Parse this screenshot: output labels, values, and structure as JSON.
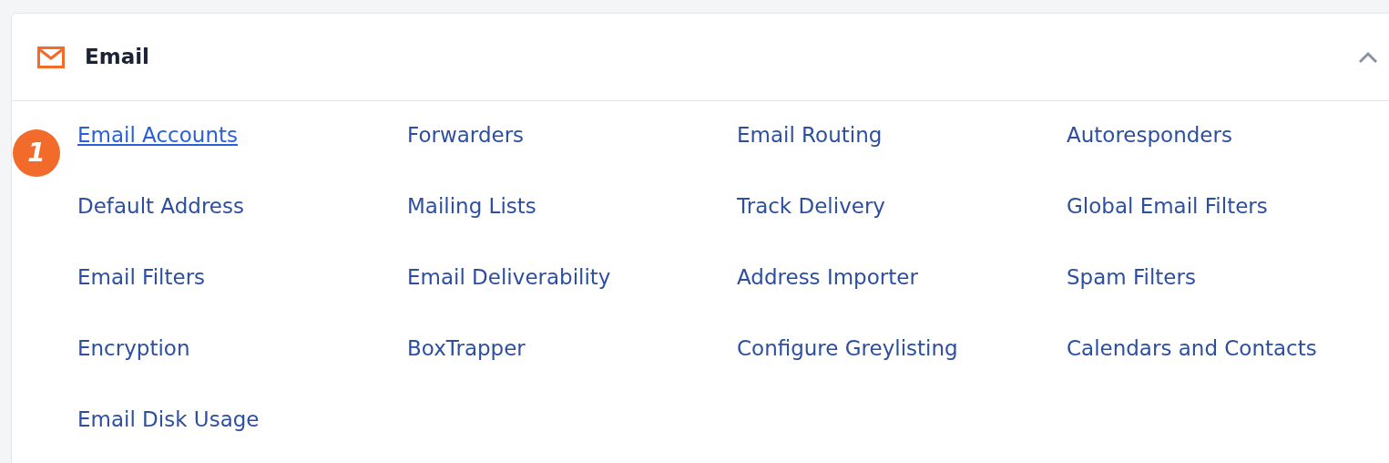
{
  "section": {
    "title": "Email",
    "expanded": true
  },
  "callout": {
    "label": "1"
  },
  "links": [
    {
      "label": "Email Accounts",
      "highlighted": true
    },
    {
      "label": "Forwarders",
      "highlighted": false
    },
    {
      "label": "Email Routing",
      "highlighted": false
    },
    {
      "label": "Autoresponders",
      "highlighted": false
    },
    {
      "label": "Default Address",
      "highlighted": false
    },
    {
      "label": "Mailing Lists",
      "highlighted": false
    },
    {
      "label": "Track Delivery",
      "highlighted": false
    },
    {
      "label": "Global Email Filters",
      "highlighted": false
    },
    {
      "label": "Email Filters",
      "highlighted": false
    },
    {
      "label": "Email Deliverability",
      "highlighted": false
    },
    {
      "label": "Address Importer",
      "highlighted": false
    },
    {
      "label": "Spam Filters",
      "highlighted": false
    },
    {
      "label": "Encryption",
      "highlighted": false
    },
    {
      "label": "BoxTrapper",
      "highlighted": false
    },
    {
      "label": "Configure Greylisting",
      "highlighted": false
    },
    {
      "label": "Calendars and Contacts",
      "highlighted": false
    },
    {
      "label": "Email Disk Usage",
      "highlighted": false
    }
  ]
}
